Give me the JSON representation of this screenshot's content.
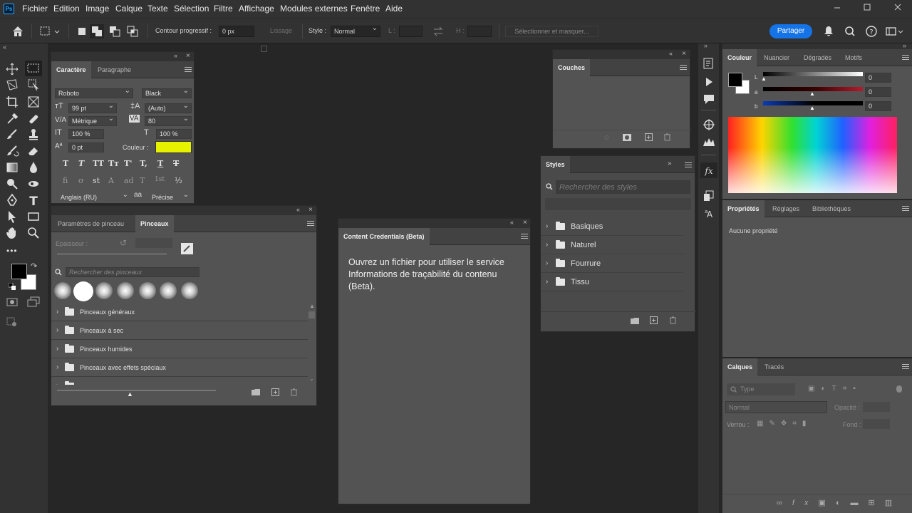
{
  "app": {
    "logo": "Ps"
  },
  "menubar": {
    "items": [
      "Fichier",
      "Edition",
      "Image",
      "Calque",
      "Texte",
      "Sélection",
      "Filtre",
      "Affichage",
      "Modules externes",
      "Fenêtre",
      "Aide"
    ]
  },
  "options": {
    "feather_label": "Contour progressif :",
    "feather_value": "0 px",
    "antialias_label": "Lissage",
    "style_label": "Style :",
    "style_value": "Normal",
    "width_label": "L :",
    "height_label": "H :",
    "select_mask_label": "Sélectionner et masquer...",
    "share_label": "Partager"
  },
  "character": {
    "tab1": "Caractère",
    "tab2": "Paragraphe",
    "font_family": "Roboto",
    "font_style": "Black",
    "font_size": "99 pt",
    "leading": "(Auto)",
    "kerning": "Métrique",
    "tracking": "80",
    "vscale": "100 %",
    "hscale": "100 %",
    "baseline": "0 pt",
    "color_label": "Couleur :",
    "color_value": "#e6f200",
    "language": "Anglais (RU)",
    "antialias": "Précise",
    "aa_icon": "aa",
    "style_buttons": [
      "T",
      "T",
      "TT",
      "Tт",
      "T'",
      "T,",
      "T",
      "T"
    ],
    "opentype": [
      "fi",
      "ơ",
      "st",
      "A",
      "ad",
      "T",
      "1st",
      "½"
    ]
  },
  "brushes": {
    "tab1": "Paramètres de pinceau",
    "tab2": "Pinceaux",
    "size_label": "Epaisseur :",
    "search_placeholder": "Rechercher des pinceaux",
    "groups": [
      "Pinceaux généraux",
      "Pinceaux à sec",
      "Pinceaux humides",
      "Pinceaux avec effets spéciaux"
    ]
  },
  "channels": {
    "tab": "Couches"
  },
  "credentials": {
    "tab": "Content Credentials (Beta)",
    "message": "Ouvrez un fichier pour utiliser le service Informations de traçabilité du contenu (Beta)."
  },
  "styles": {
    "tab": "Styles",
    "search_placeholder": "Rechercher des styles",
    "groups": [
      "Basiques",
      "Naturel",
      "Fourrure",
      "Tissu"
    ]
  },
  "color": {
    "tabs": [
      "Couleur",
      "Nuancier",
      "Dégradés",
      "Motifs"
    ],
    "sliders": [
      {
        "label": "L",
        "value": "0"
      },
      {
        "label": "a",
        "value": "0"
      },
      {
        "label": "b",
        "value": "0"
      }
    ],
    "foreground": "#000000",
    "background": "#ffffff"
  },
  "properties": {
    "tabs": [
      "Propriétés",
      "Réglages",
      "Bibliothèques"
    ],
    "empty": "Aucune propriété"
  },
  "layers": {
    "tabs": [
      "Calques",
      "Tracés"
    ],
    "kind_placeholder": "Type",
    "blend_mode": "Normal",
    "opacity_label": "Opacité :",
    "lock_label": "Verrou :",
    "fill_label": "Fond :"
  }
}
